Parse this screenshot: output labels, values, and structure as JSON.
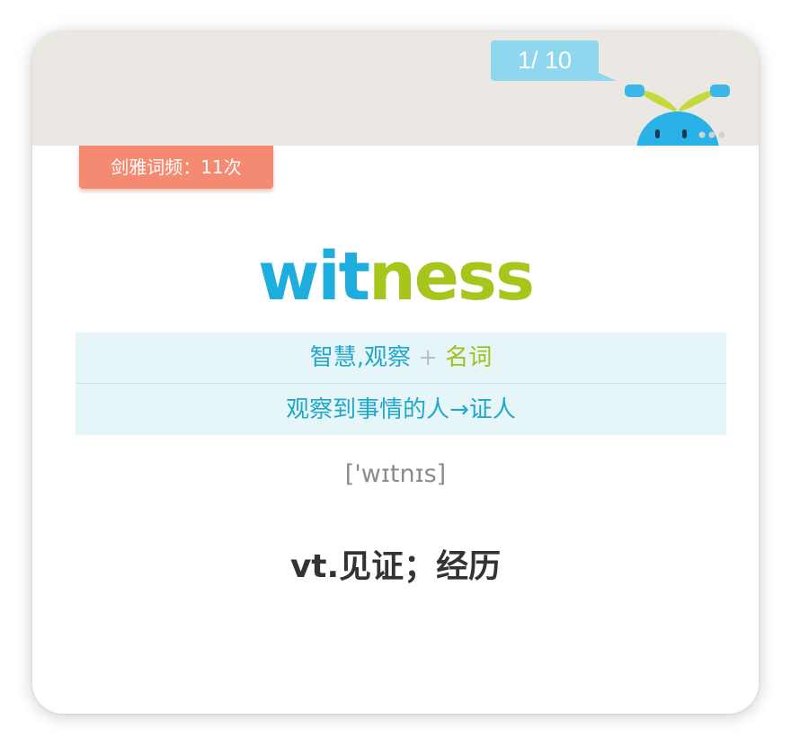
{
  "header": {
    "progress": "1/ 10",
    "progress_bubble_color": "#8fd7ef",
    "mascot": "blue-sprout-mascot-icon"
  },
  "card": {
    "frequency_badge": "剑雅词频：11次",
    "frequency_badge_color": "#f58a73",
    "word": {
      "root": "wit",
      "suffix": "ness",
      "root_color": "#1eaede",
      "suffix_color": "#a6c61b"
    },
    "etymology": {
      "root_meaning": "智慧,观察",
      "plus": "+",
      "suffix_meaning": "名词",
      "explanation": "观察到事情的人→证人"
    },
    "phonetic": "['wɪtnɪs]",
    "definition": "vt.见证；经历"
  }
}
